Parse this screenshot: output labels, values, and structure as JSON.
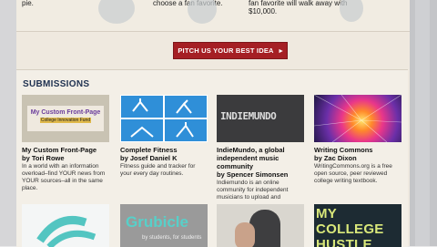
{
  "top": {
    "col1": "pie.",
    "col2": "choose a fan favorite.",
    "col3_line1": "fan favorite will walk away with",
    "col3_line2": "$10,000."
  },
  "pitch_button": "PITCH US YOUR BEST IDEA",
  "pitch_arrow": "▸",
  "submissions": {
    "heading": "SUBMISSIONS",
    "items": [
      {
        "thumb_title": "My Custom Front-Page",
        "thumb_sub": "College Innovation Fund",
        "title": "My Custom Front-Page",
        "author": "by Tori Rowe",
        "desc": "In a world with an information overload–find YOUR news from YOUR sources–all in the same place."
      },
      {
        "title": "Complete Fitness",
        "author": "by Josef Daniel K",
        "desc": "Fitness guide and tracker for your every day routines."
      },
      {
        "thumb_text": "INDIEMUNDO",
        "title": "IndieMundo, a global independent music community",
        "author": "by Spencer Simonsen",
        "desc": "Indiemundo is an online community for independent musicians to upload and"
      },
      {
        "title": "Writing Commons",
        "author": "by Zac Dixon",
        "desc": "WritingCommons.org is a free open source, peer reviewed college writing textbook."
      }
    ],
    "row2": [
      {
        "label": ""
      },
      {
        "label": "Grubicle",
        "sub": "by students, for students"
      },
      {
        "label": ""
      },
      {
        "label": "MY COLLEGE HUSTLE"
      }
    ]
  },
  "colors": {
    "button": "#a51f24",
    "heading": "#1f3150",
    "fitness_blue": "#2f8fd8"
  }
}
